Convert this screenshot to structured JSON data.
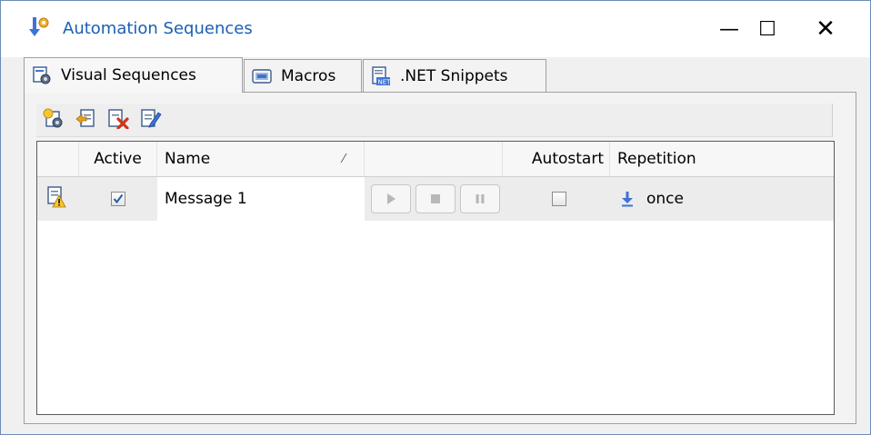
{
  "window": {
    "title": "Automation Sequences",
    "minimize_glyph": "—",
    "maximize_glyph": "☐",
    "close_glyph": "✕"
  },
  "tabs": [
    {
      "label": "Visual Sequences",
      "icon": "visual-sequences-icon",
      "active": true
    },
    {
      "label": "Macros",
      "icon": "macros-icon",
      "active": false
    },
    {
      "label": ".NET Snippets",
      "icon": "net-snippets-icon",
      "active": false
    }
  ],
  "toolbar": {
    "buttons": [
      "new-sequence-icon",
      "import-sequence-icon",
      "delete-sequence-icon",
      "edit-sequence-icon"
    ]
  },
  "grid": {
    "columns": [
      "",
      "Active",
      "Name",
      "",
      "Autostart",
      "Repetition"
    ],
    "sort_indicator": "⁄",
    "rows": [
      {
        "status_icon": "sequence-warning-icon",
        "active": true,
        "name": "Message 1",
        "autostart": false,
        "repetition": "once",
        "repetition_icon": "arrow-down-icon"
      }
    ]
  },
  "colors": {
    "title": "#1a5fb4",
    "accent": "#3d73d6",
    "row_background": "#ececec"
  }
}
